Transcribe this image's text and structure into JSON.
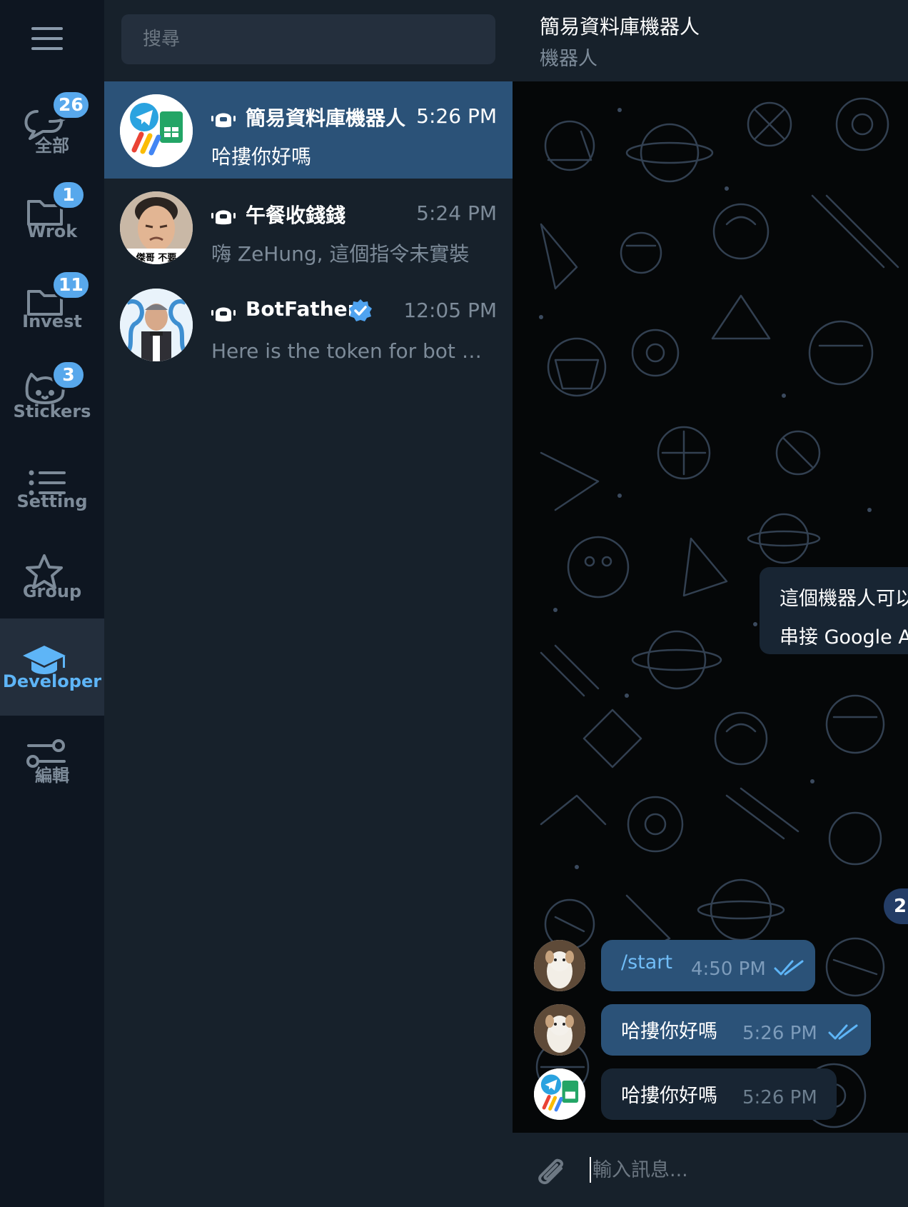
{
  "sidebar": {
    "folders": [
      {
        "label": "全部",
        "badge": "26",
        "icon": "chat-bubbles-icon"
      },
      {
        "label": "Wrok",
        "badge": "1",
        "icon": "folder-icon"
      },
      {
        "label": "Invest",
        "badge": "11",
        "icon": "folder-icon"
      },
      {
        "label": "Stickers",
        "badge": "3",
        "icon": "cat-face-icon"
      },
      {
        "label": "Setting",
        "badge": "",
        "icon": "list-icon"
      },
      {
        "label": "Group",
        "badge": "",
        "icon": "star-icon"
      },
      {
        "label": "Developer",
        "badge": "",
        "icon": "graduation-cap-icon",
        "active": true
      },
      {
        "label": "編輯",
        "badge": "",
        "icon": "sliders-icon"
      }
    ]
  },
  "search": {
    "placeholder": "搜尋"
  },
  "chats": [
    {
      "name": "簡易資料庫機器人",
      "time": "5:26 PM",
      "preview": "哈摟你好嗎",
      "is_bot": true,
      "active": true
    },
    {
      "name": "午餐收錢錢",
      "time": "5:24 PM",
      "preview": "嗨 ZeHung, 這個指令未實裝",
      "is_bot": true,
      "avatar_caption": "傑哥 不要"
    },
    {
      "name": "BotFather",
      "time": "12:05 PM",
      "preview": "Here is the token for bot 簡...",
      "is_bot": true,
      "verified": true
    }
  ],
  "chat": {
    "title": "簡易資料庫機器人",
    "subtitle": "機器人",
    "info": {
      "line1": "這個機器人可以",
      "line2": "串接 Google A"
    },
    "scroll_badge": "2",
    "messages": [
      {
        "text": "/start",
        "time": "4:50 PM",
        "direction": "out",
        "read": true
      },
      {
        "text": "哈摟你好嗎",
        "time": "5:26 PM",
        "direction": "out",
        "read": true
      },
      {
        "text": "哈摟你好嗎",
        "time": "5:26 PM",
        "direction": "in"
      }
    ],
    "composer": {
      "placeholder": "輸入訊息..."
    }
  },
  "colors": {
    "rail_bg": "#0e1621",
    "list_bg": "#17212b",
    "active_row": "#2b5278",
    "accent": "#5eb5f7",
    "badge": "#58a8ec",
    "muted_text": "#7d8b99"
  }
}
